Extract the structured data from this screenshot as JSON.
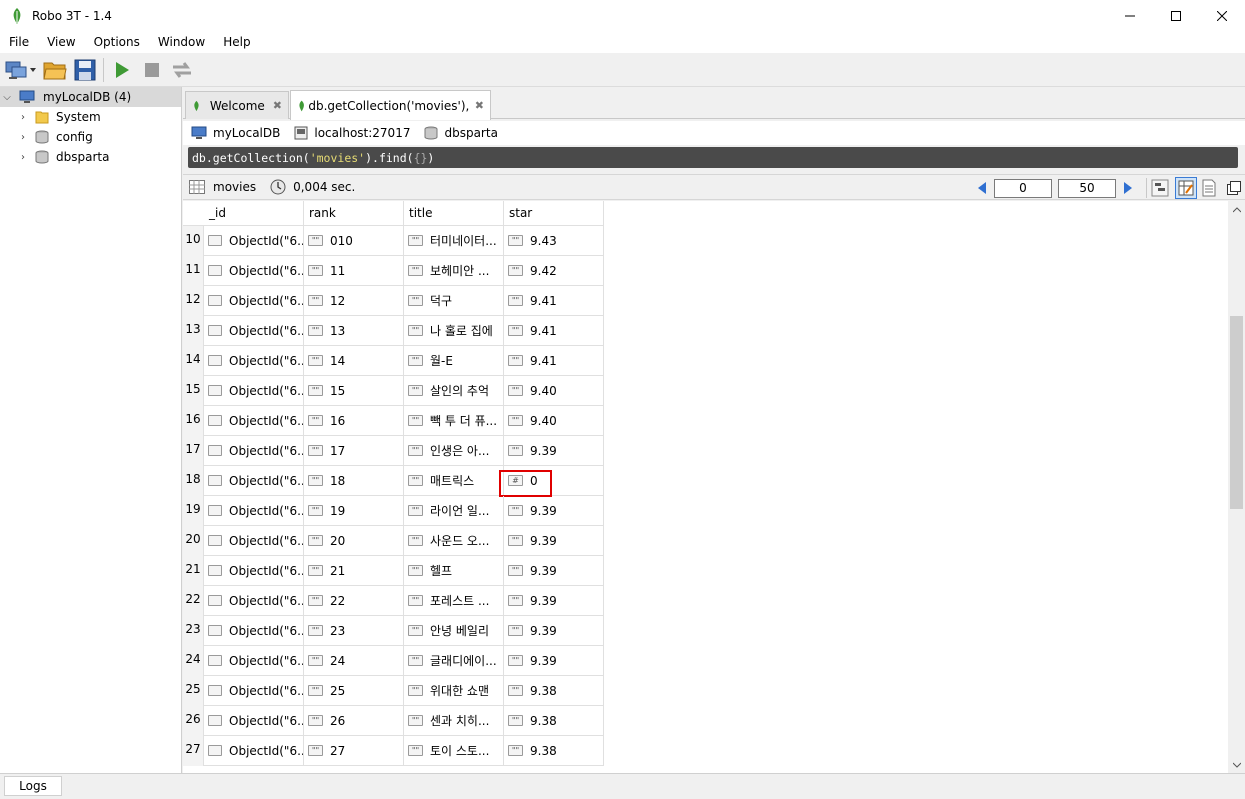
{
  "window": {
    "title": "Robo 3T - 1.4"
  },
  "menu": [
    "File",
    "View",
    "Options",
    "Window",
    "Help"
  ],
  "tree": {
    "root": "myLocalDB (4)",
    "children": [
      "System",
      "config",
      "dbsparta"
    ]
  },
  "tabs": [
    {
      "label": "Welcome"
    },
    {
      "label": "db.getCollection('movies'),…"
    }
  ],
  "connection": {
    "server": "myLocalDB",
    "host": "localhost:27017",
    "database": "dbsparta"
  },
  "query": {
    "prefix": "db.getCollection(",
    "collection": "'movies'",
    "middle": ").find(",
    "args": "{}",
    "suffix": ")"
  },
  "results": {
    "collection": "movies",
    "time": "0,004 sec.",
    "skip": "0",
    "limit": "50"
  },
  "table": {
    "columns": [
      "_id",
      "rank",
      "title",
      "star"
    ],
    "type_badge_string": "\"\"",
    "type_badge_number": "#",
    "rows": [
      {
        "n": "10",
        "id": "ObjectId(\"6...",
        "rank": "010",
        "title": "터미네이터...",
        "star": "9.43",
        "star_type": "string"
      },
      {
        "n": "11",
        "id": "ObjectId(\"6...",
        "rank": "11",
        "title": "보헤미안 ...",
        "star": "9.42",
        "star_type": "string"
      },
      {
        "n": "12",
        "id": "ObjectId(\"6...",
        "rank": "12",
        "title": "덕구",
        "star": "9.41",
        "star_type": "string"
      },
      {
        "n": "13",
        "id": "ObjectId(\"6...",
        "rank": "13",
        "title": "나 홀로 집에",
        "star": "9.41",
        "star_type": "string"
      },
      {
        "n": "14",
        "id": "ObjectId(\"6...",
        "rank": "14",
        "title": "월-E",
        "star": "9.41",
        "star_type": "string"
      },
      {
        "n": "15",
        "id": "ObjectId(\"6...",
        "rank": "15",
        "title": "살인의 추억",
        "star": "9.40",
        "star_type": "string"
      },
      {
        "n": "16",
        "id": "ObjectId(\"6...",
        "rank": "16",
        "title": "빽 투 더 퓨...",
        "star": "9.40",
        "star_type": "string"
      },
      {
        "n": "17",
        "id": "ObjectId(\"6...",
        "rank": "17",
        "title": "인생은 아...",
        "star": "9.39",
        "star_type": "string"
      },
      {
        "n": "18",
        "id": "ObjectId(\"6...",
        "rank": "18",
        "title": "매트릭스",
        "star": "0",
        "star_type": "number"
      },
      {
        "n": "19",
        "id": "ObjectId(\"6...",
        "rank": "19",
        "title": "라이언 일...",
        "star": "9.39",
        "star_type": "string"
      },
      {
        "n": "20",
        "id": "ObjectId(\"6...",
        "rank": "20",
        "title": "사운드 오...",
        "star": "9.39",
        "star_type": "string"
      },
      {
        "n": "21",
        "id": "ObjectId(\"6...",
        "rank": "21",
        "title": "헬프",
        "star": "9.39",
        "star_type": "string"
      },
      {
        "n": "22",
        "id": "ObjectId(\"6...",
        "rank": "22",
        "title": "포레스트 ...",
        "star": "9.39",
        "star_type": "string"
      },
      {
        "n": "23",
        "id": "ObjectId(\"6...",
        "rank": "23",
        "title": "안녕 베일리",
        "star": "9.39",
        "star_type": "string"
      },
      {
        "n": "24",
        "id": "ObjectId(\"6...",
        "rank": "24",
        "title": "글래디에이...",
        "star": "9.39",
        "star_type": "string"
      },
      {
        "n": "25",
        "id": "ObjectId(\"6...",
        "rank": "25",
        "title": "위대한 쇼맨",
        "star": "9.38",
        "star_type": "string"
      },
      {
        "n": "26",
        "id": "ObjectId(\"6...",
        "rank": "26",
        "title": "센과 치히...",
        "star": "9.38",
        "star_type": "string"
      },
      {
        "n": "27",
        "id": "ObjectId(\"6...",
        "rank": "27",
        "title": "토이 스토...",
        "star": "9.38",
        "star_type": "string"
      }
    ]
  },
  "statusbar": {
    "logs": "Logs"
  },
  "colors": {
    "highlight": "#e00000",
    "query_bg": "#4a4a4a",
    "query_string": "#e6db74",
    "tree_selected": "#d9d9d9"
  }
}
